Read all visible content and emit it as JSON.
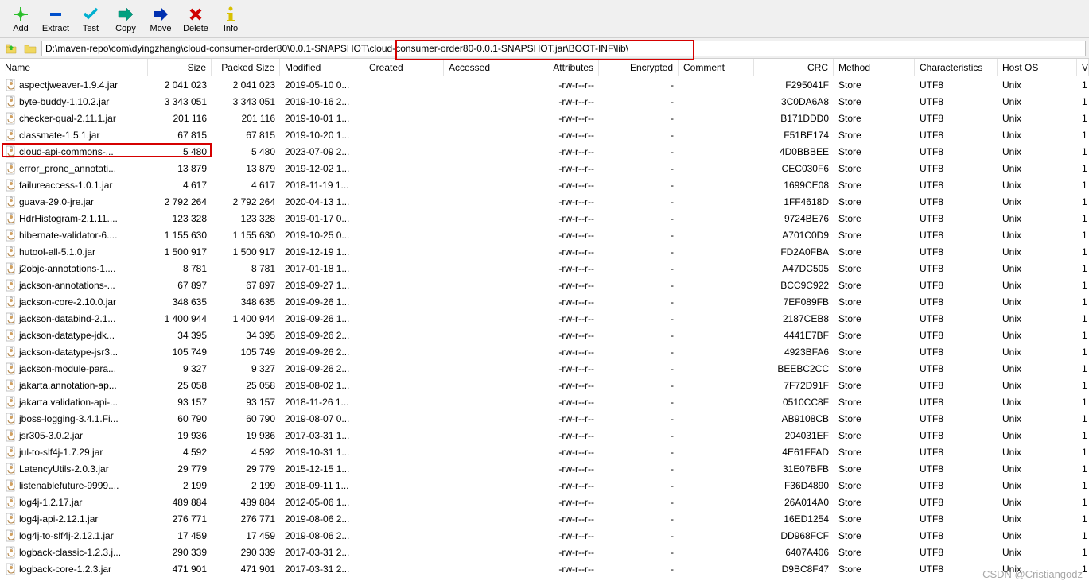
{
  "toolbar": {
    "add": "Add",
    "extract": "Extract",
    "test": "Test",
    "copy": "Copy",
    "move": "Move",
    "delete": "Delete",
    "info": "Info"
  },
  "path": "D:\\maven-repo\\com\\dyingzhang\\cloud-consumer-order80\\0.0.1-SNAPSHOT\\cloud-consumer-order80-0.0.1-SNAPSHOT.jar\\BOOT-INF\\lib\\",
  "columns": {
    "name": "Name",
    "size": "Size",
    "packed": "Packed Size",
    "modified": "Modified",
    "created": "Created",
    "accessed": "Accessed",
    "attributes": "Attributes",
    "encrypted": "Encrypted",
    "comment": "Comment",
    "crc": "CRC",
    "method": "Method",
    "characteristics": "Characteristics",
    "host": "Host OS",
    "version": "V"
  },
  "rows": [
    {
      "name": "aspectjweaver-1.9.4.jar",
      "size": "2 041 023",
      "packed": "2 041 023",
      "modified": "2019-05-10 0...",
      "attrs": "-rw-r--r--",
      "enc": "-",
      "crc": "F295041F",
      "method": "Store",
      "char": "UTF8",
      "host": "Unix",
      "ver": "1"
    },
    {
      "name": "byte-buddy-1.10.2.jar",
      "size": "3 343 051",
      "packed": "3 343 051",
      "modified": "2019-10-16 2...",
      "attrs": "-rw-r--r--",
      "enc": "-",
      "crc": "3C0DA6A8",
      "method": "Store",
      "char": "UTF8",
      "host": "Unix",
      "ver": "1"
    },
    {
      "name": "checker-qual-2.11.1.jar",
      "size": "201 116",
      "packed": "201 116",
      "modified": "2019-10-01 1...",
      "attrs": "-rw-r--r--",
      "enc": "-",
      "crc": "B171DDD0",
      "method": "Store",
      "char": "UTF8",
      "host": "Unix",
      "ver": "1"
    },
    {
      "name": "classmate-1.5.1.jar",
      "size": "67 815",
      "packed": "67 815",
      "modified": "2019-10-20 1...",
      "attrs": "-rw-r--r--",
      "enc": "-",
      "crc": "F51BE174",
      "method": "Store",
      "char": "UTF8",
      "host": "Unix",
      "ver": "1"
    },
    {
      "name": "cloud-api-commons-...",
      "size": "5 480",
      "packed": "5 480",
      "modified": "2023-07-09 2...",
      "attrs": "-rw-r--r--",
      "enc": "-",
      "crc": "4D0BBBEE",
      "method": "Store",
      "char": "UTF8",
      "host": "Unix",
      "ver": "1"
    },
    {
      "name": "error_prone_annotati...",
      "size": "13 879",
      "packed": "13 879",
      "modified": "2019-12-02 1...",
      "attrs": "-rw-r--r--",
      "enc": "-",
      "crc": "CEC030F6",
      "method": "Store",
      "char": "UTF8",
      "host": "Unix",
      "ver": "1"
    },
    {
      "name": "failureaccess-1.0.1.jar",
      "size": "4 617",
      "packed": "4 617",
      "modified": "2018-11-19 1...",
      "attrs": "-rw-r--r--",
      "enc": "-",
      "crc": "1699CE08",
      "method": "Store",
      "char": "UTF8",
      "host": "Unix",
      "ver": "1"
    },
    {
      "name": "guava-29.0-jre.jar",
      "size": "2 792 264",
      "packed": "2 792 264",
      "modified": "2020-04-13 1...",
      "attrs": "-rw-r--r--",
      "enc": "-",
      "crc": "1FF4618D",
      "method": "Store",
      "char": "UTF8",
      "host": "Unix",
      "ver": "1"
    },
    {
      "name": "HdrHistogram-2.1.11....",
      "size": "123 328",
      "packed": "123 328",
      "modified": "2019-01-17 0...",
      "attrs": "-rw-r--r--",
      "enc": "-",
      "crc": "9724BE76",
      "method": "Store",
      "char": "UTF8",
      "host": "Unix",
      "ver": "1"
    },
    {
      "name": "hibernate-validator-6....",
      "size": "1 155 630",
      "packed": "1 155 630",
      "modified": "2019-10-25 0...",
      "attrs": "-rw-r--r--",
      "enc": "-",
      "crc": "A701C0D9",
      "method": "Store",
      "char": "UTF8",
      "host": "Unix",
      "ver": "1"
    },
    {
      "name": "hutool-all-5.1.0.jar",
      "size": "1 500 917",
      "packed": "1 500 917",
      "modified": "2019-12-19 1...",
      "attrs": "-rw-r--r--",
      "enc": "-",
      "crc": "FD2A0FBA",
      "method": "Store",
      "char": "UTF8",
      "host": "Unix",
      "ver": "1"
    },
    {
      "name": "j2objc-annotations-1....",
      "size": "8 781",
      "packed": "8 781",
      "modified": "2017-01-18 1...",
      "attrs": "-rw-r--r--",
      "enc": "-",
      "crc": "A47DC505",
      "method": "Store",
      "char": "UTF8",
      "host": "Unix",
      "ver": "1"
    },
    {
      "name": "jackson-annotations-...",
      "size": "67 897",
      "packed": "67 897",
      "modified": "2019-09-27 1...",
      "attrs": "-rw-r--r--",
      "enc": "-",
      "crc": "BCC9C922",
      "method": "Store",
      "char": "UTF8",
      "host": "Unix",
      "ver": "1"
    },
    {
      "name": "jackson-core-2.10.0.jar",
      "size": "348 635",
      "packed": "348 635",
      "modified": "2019-09-26 1...",
      "attrs": "-rw-r--r--",
      "enc": "-",
      "crc": "7EF089FB",
      "method": "Store",
      "char": "UTF8",
      "host": "Unix",
      "ver": "1"
    },
    {
      "name": "jackson-databind-2.1...",
      "size": "1 400 944",
      "packed": "1 400 944",
      "modified": "2019-09-26 1...",
      "attrs": "-rw-r--r--",
      "enc": "-",
      "crc": "2187CEB8",
      "method": "Store",
      "char": "UTF8",
      "host": "Unix",
      "ver": "1"
    },
    {
      "name": "jackson-datatype-jdk...",
      "size": "34 395",
      "packed": "34 395",
      "modified": "2019-09-26 2...",
      "attrs": "-rw-r--r--",
      "enc": "-",
      "crc": "4441E7BF",
      "method": "Store",
      "char": "UTF8",
      "host": "Unix",
      "ver": "1"
    },
    {
      "name": "jackson-datatype-jsr3...",
      "size": "105 749",
      "packed": "105 749",
      "modified": "2019-09-26 2...",
      "attrs": "-rw-r--r--",
      "enc": "-",
      "crc": "4923BFA6",
      "method": "Store",
      "char": "UTF8",
      "host": "Unix",
      "ver": "1"
    },
    {
      "name": "jackson-module-para...",
      "size": "9 327",
      "packed": "9 327",
      "modified": "2019-09-26 2...",
      "attrs": "-rw-r--r--",
      "enc": "-",
      "crc": "BEEBC2CC",
      "method": "Store",
      "char": "UTF8",
      "host": "Unix",
      "ver": "1"
    },
    {
      "name": "jakarta.annotation-ap...",
      "size": "25 058",
      "packed": "25 058",
      "modified": "2019-08-02 1...",
      "attrs": "-rw-r--r--",
      "enc": "-",
      "crc": "7F72D91F",
      "method": "Store",
      "char": "UTF8",
      "host": "Unix",
      "ver": "1"
    },
    {
      "name": "jakarta.validation-api-...",
      "size": "93 157",
      "packed": "93 157",
      "modified": "2018-11-26 1...",
      "attrs": "-rw-r--r--",
      "enc": "-",
      "crc": "0510CC8F",
      "method": "Store",
      "char": "UTF8",
      "host": "Unix",
      "ver": "1"
    },
    {
      "name": "jboss-logging-3.4.1.Fi...",
      "size": "60 790",
      "packed": "60 790",
      "modified": "2019-08-07 0...",
      "attrs": "-rw-r--r--",
      "enc": "-",
      "crc": "AB9108CB",
      "method": "Store",
      "char": "UTF8",
      "host": "Unix",
      "ver": "1"
    },
    {
      "name": "jsr305-3.0.2.jar",
      "size": "19 936",
      "packed": "19 936",
      "modified": "2017-03-31 1...",
      "attrs": "-rw-r--r--",
      "enc": "-",
      "crc": "204031EF",
      "method": "Store",
      "char": "UTF8",
      "host": "Unix",
      "ver": "1"
    },
    {
      "name": "jul-to-slf4j-1.7.29.jar",
      "size": "4 592",
      "packed": "4 592",
      "modified": "2019-10-31 1...",
      "attrs": "-rw-r--r--",
      "enc": "-",
      "crc": "4E61FFAD",
      "method": "Store",
      "char": "UTF8",
      "host": "Unix",
      "ver": "1"
    },
    {
      "name": "LatencyUtils-2.0.3.jar",
      "size": "29 779",
      "packed": "29 779",
      "modified": "2015-12-15 1...",
      "attrs": "-rw-r--r--",
      "enc": "-",
      "crc": "31E07BFB",
      "method": "Store",
      "char": "UTF8",
      "host": "Unix",
      "ver": "1"
    },
    {
      "name": "listenablefuture-9999....",
      "size": "2 199",
      "packed": "2 199",
      "modified": "2018-09-11 1...",
      "attrs": "-rw-r--r--",
      "enc": "-",
      "crc": "F36D4890",
      "method": "Store",
      "char": "UTF8",
      "host": "Unix",
      "ver": "1"
    },
    {
      "name": "log4j-1.2.17.jar",
      "size": "489 884",
      "packed": "489 884",
      "modified": "2012-05-06 1...",
      "attrs": "-rw-r--r--",
      "enc": "-",
      "crc": "26A014A0",
      "method": "Store",
      "char": "UTF8",
      "host": "Unix",
      "ver": "1"
    },
    {
      "name": "log4j-api-2.12.1.jar",
      "size": "276 771",
      "packed": "276 771",
      "modified": "2019-08-06 2...",
      "attrs": "-rw-r--r--",
      "enc": "-",
      "crc": "16ED1254",
      "method": "Store",
      "char": "UTF8",
      "host": "Unix",
      "ver": "1"
    },
    {
      "name": "log4j-to-slf4j-2.12.1.jar",
      "size": "17 459",
      "packed": "17 459",
      "modified": "2019-08-06 2...",
      "attrs": "-rw-r--r--",
      "enc": "-",
      "crc": "DD968FCF",
      "method": "Store",
      "char": "UTF8",
      "host": "Unix",
      "ver": "1"
    },
    {
      "name": "logback-classic-1.2.3.j...",
      "size": "290 339",
      "packed": "290 339",
      "modified": "2017-03-31 2...",
      "attrs": "-rw-r--r--",
      "enc": "-",
      "crc": "6407A406",
      "method": "Store",
      "char": "UTF8",
      "host": "Unix",
      "ver": "1"
    },
    {
      "name": "logback-core-1.2.3.jar",
      "size": "471 901",
      "packed": "471 901",
      "modified": "2017-03-31 2...",
      "attrs": "-rw-r--r--",
      "enc": "-",
      "crc": "D9BC8F47",
      "method": "Store",
      "char": "UTF8",
      "host": "Unix",
      "ver": "1"
    }
  ],
  "watermark": "CSDN @Cristiangodz"
}
